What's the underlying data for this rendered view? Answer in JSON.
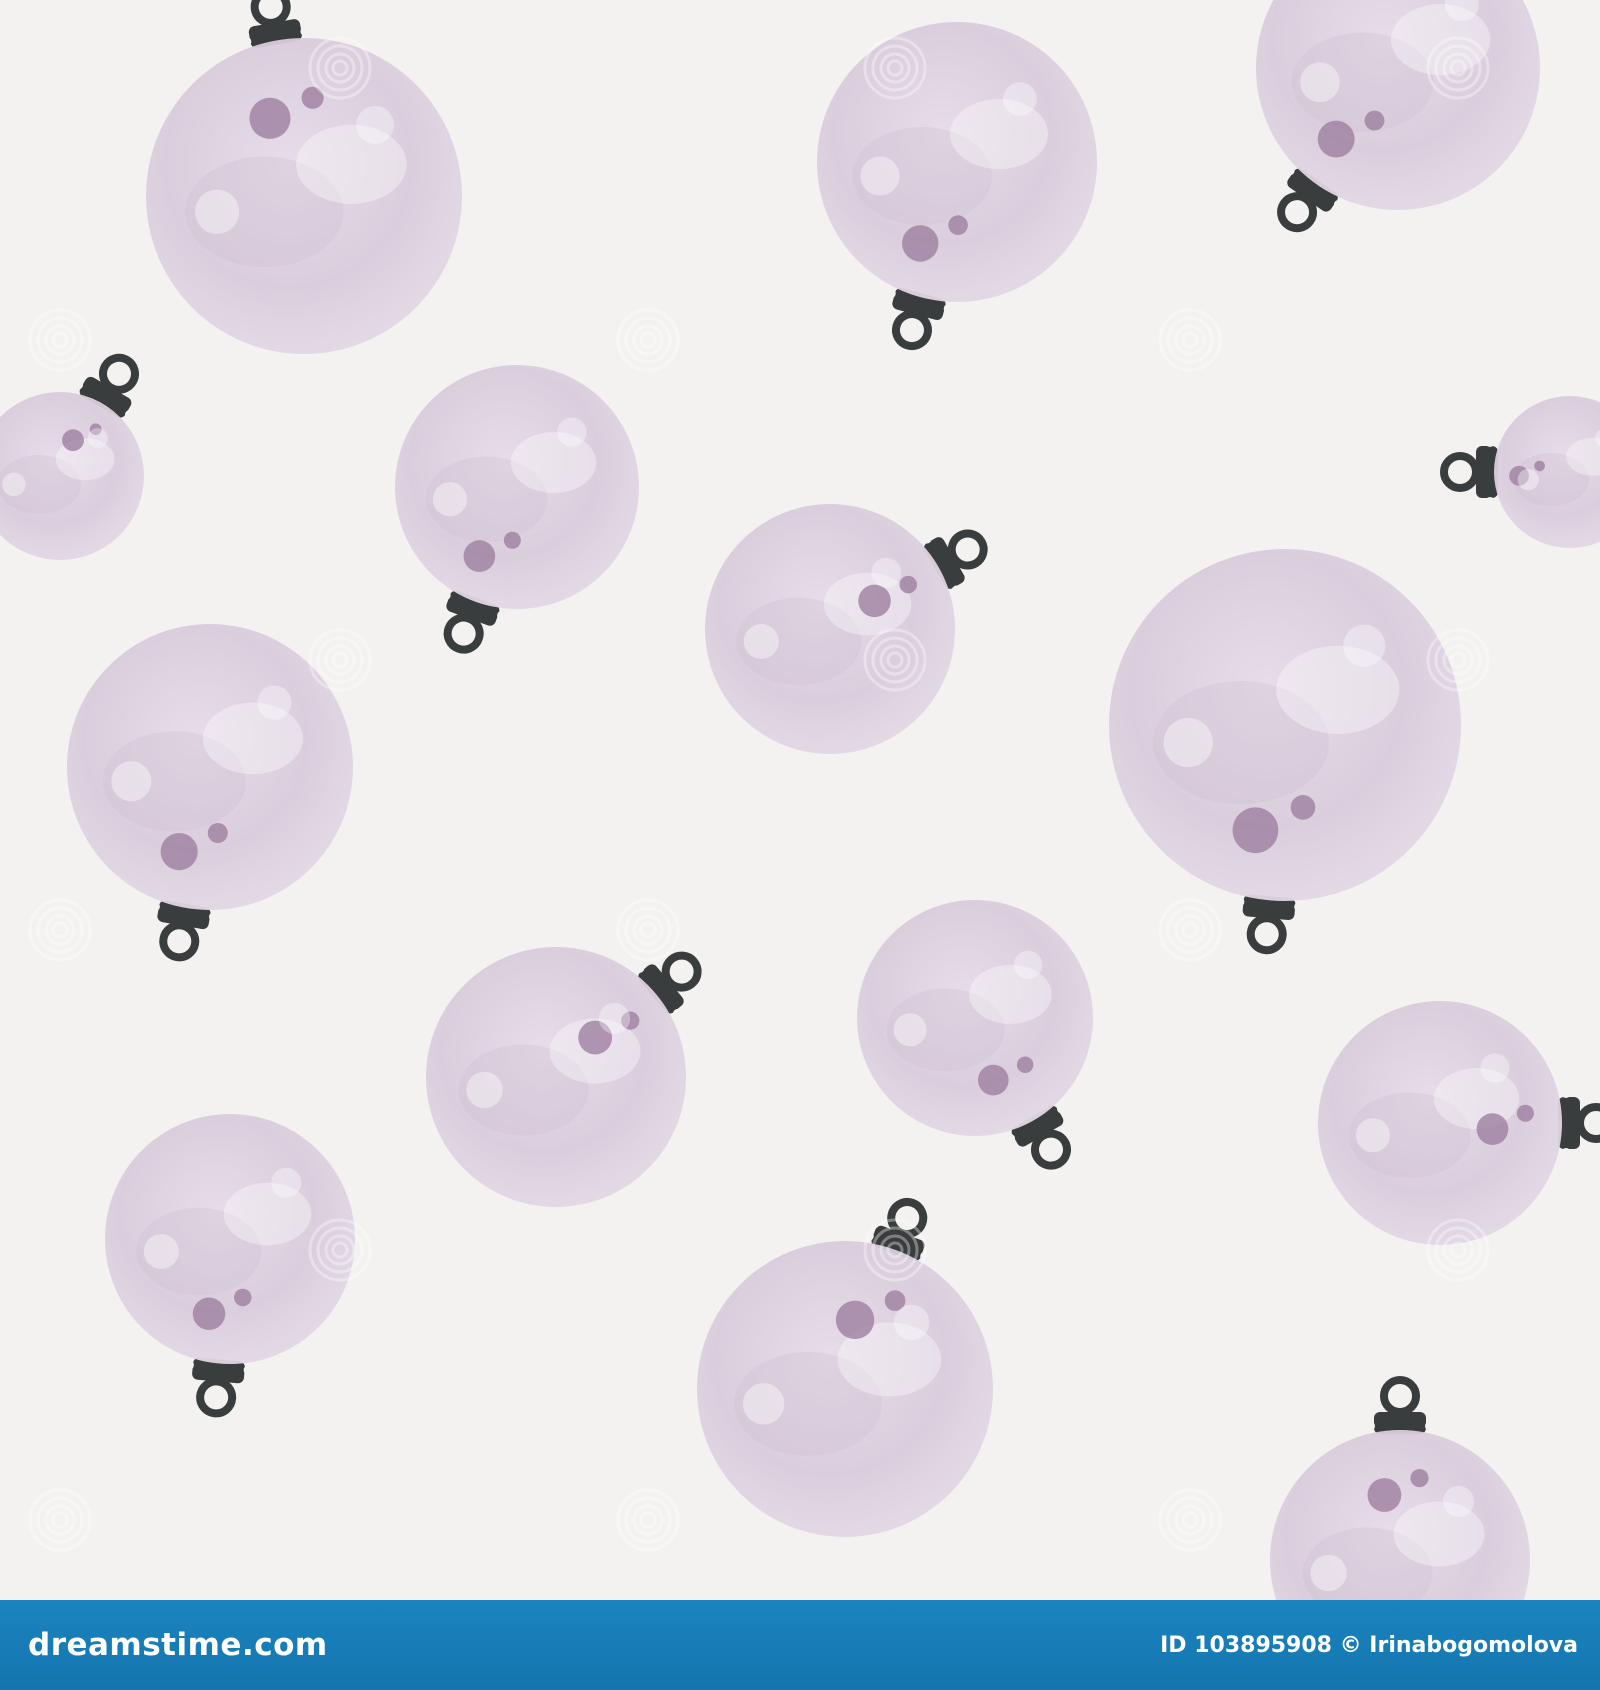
{
  "image": {
    "description_label": "",
    "background_color": "#f3f2f1",
    "ornament_color": "#dcd0de",
    "cap_color": "#3a3d3d",
    "spot_color": "#9e7fa0"
  },
  "watermark": {
    "text": "dreamstime",
    "icon": "spiral-logo-icon"
  },
  "footer": {
    "brand": "dreamstime.com",
    "credits": "ID 103895908 © Irinabogomolova",
    "background_color": "#1a7cb7"
  }
}
